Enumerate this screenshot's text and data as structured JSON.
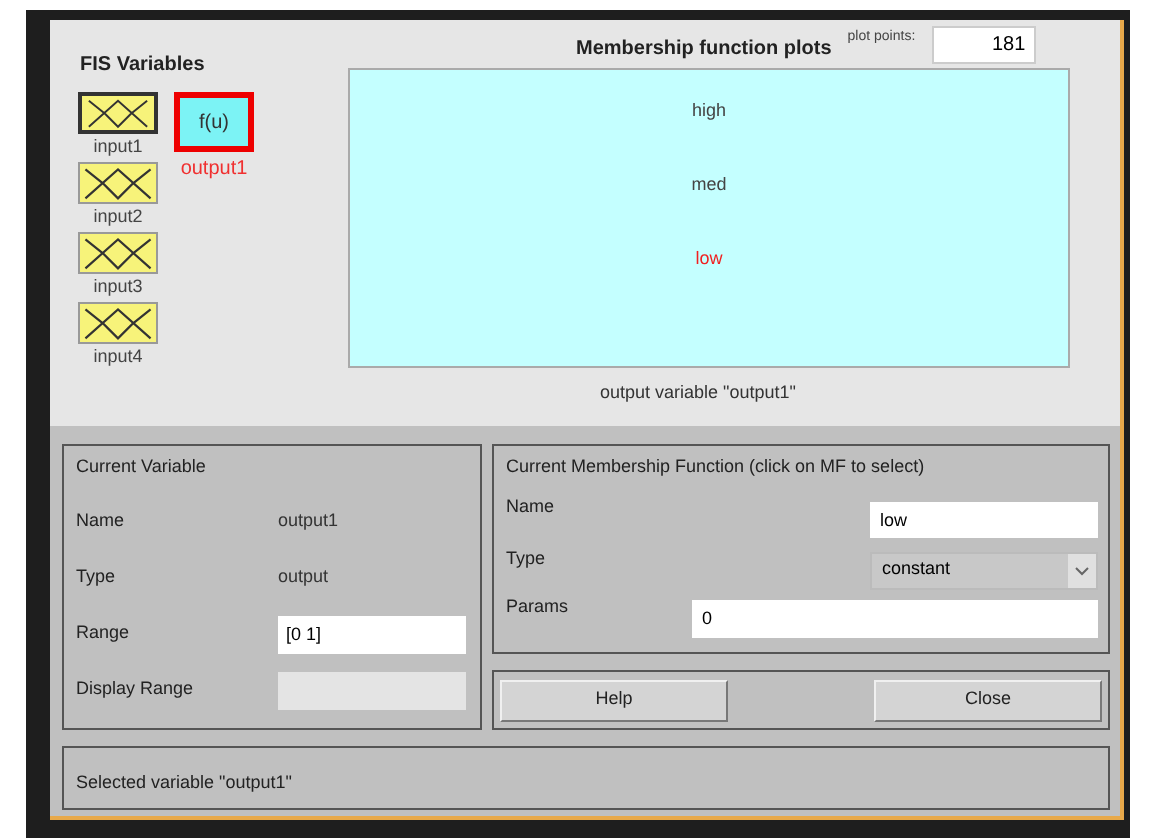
{
  "fis_variables": {
    "title": "FIS Variables",
    "inputs": [
      {
        "label": "input1",
        "selected": false
      },
      {
        "label": "input2",
        "selected": false
      },
      {
        "label": "input3",
        "selected": false
      },
      {
        "label": "input4",
        "selected": false
      }
    ],
    "outputs": [
      {
        "symbol": "f(u)",
        "label": "output1",
        "selected": true
      }
    ]
  },
  "plot": {
    "title": "Membership function plots",
    "plot_points_label": "plot points:",
    "plot_points": "181",
    "mfs": [
      {
        "label": "high",
        "selected": false
      },
      {
        "label": "med",
        "selected": false
      },
      {
        "label": "low",
        "selected": true
      }
    ],
    "caption": "output variable \"output1\""
  },
  "current_variable": {
    "title": "Current Variable",
    "name_label": "Name",
    "name": "output1",
    "type_label": "Type",
    "type": "output",
    "range_label": "Range",
    "range": "[0 1]",
    "display_range_label": "Display Range",
    "display_range_disabled": true
  },
  "current_mf": {
    "title": "Current Membership Function (click on MF to select)",
    "name_label": "Name",
    "name": "low",
    "type_label": "Type",
    "type": "constant",
    "params_label": "Params",
    "params": "0"
  },
  "buttons": [
    "Help",
    "Close"
  ],
  "status": "Selected variable \"output1\""
}
